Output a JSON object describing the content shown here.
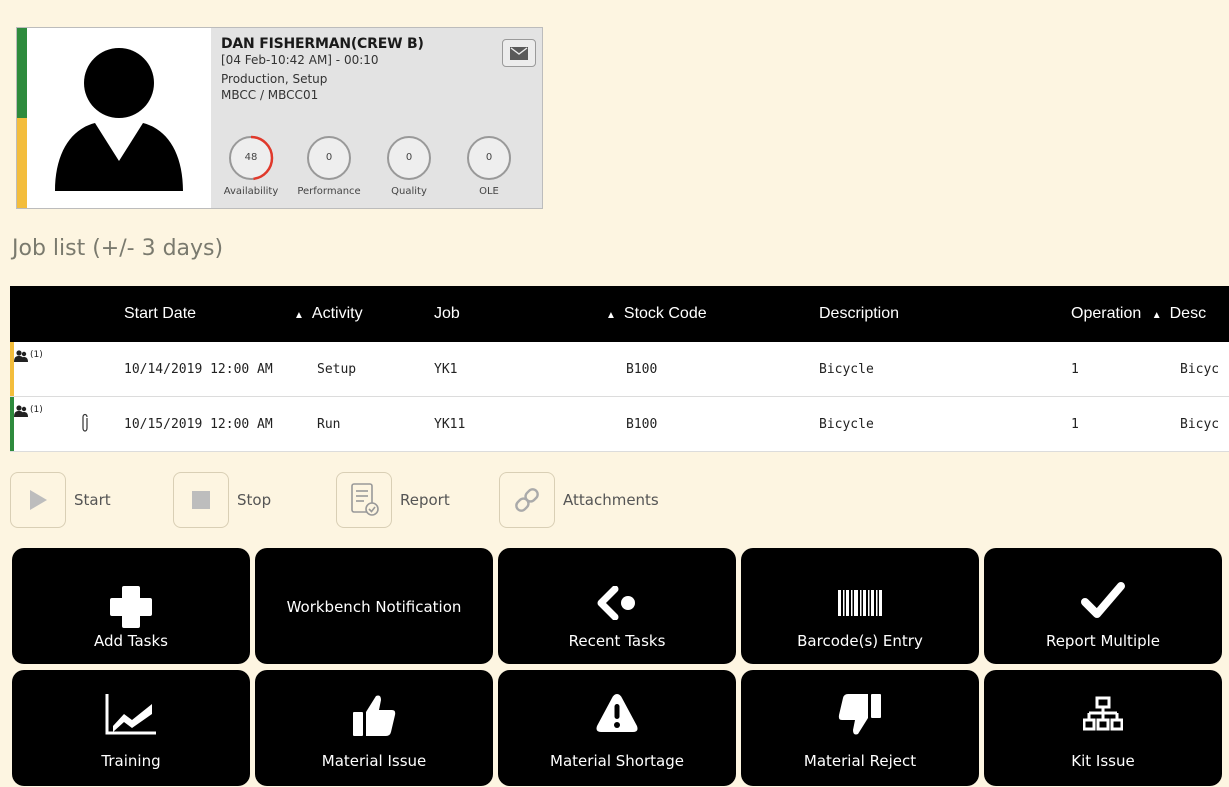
{
  "operator": {
    "name": "DAN FISHERMAN(CREW B)",
    "time": "[04 Feb-10:42 AM] - 00:10",
    "activity": "Production, Setup",
    "workcenter": "MBCC / MBCC01",
    "stripe_colors": [
      "#2e8b3d",
      "#f3bd3c"
    ],
    "gauges": [
      {
        "label": "Availability",
        "value": "48",
        "fraction": 0.48
      },
      {
        "label": "Performance",
        "value": "0",
        "fraction": 0
      },
      {
        "label": "Quality",
        "value": "0",
        "fraction": 0
      },
      {
        "label": "OLE",
        "value": "0",
        "fraction": 0
      }
    ]
  },
  "joblist": {
    "title": "Job list (+/- 3 days)",
    "columns": [
      "Start Date",
      "Activity",
      "Job",
      "Stock Code",
      "Description",
      "Operation",
      "Desc"
    ],
    "rows": [
      {
        "count": "(1)",
        "start_date": "10/14/2019 12:00 AM",
        "activity": "Setup",
        "job": "YK1",
        "stock_code": "B100",
        "description": "Bicycle",
        "operation": "1",
        "desc": "Bicyc",
        "status_color": "#f3bd3c",
        "attachment": false
      },
      {
        "count": "(1)",
        "start_date": "10/15/2019 12:00 AM",
        "activity": "Run",
        "job": "YK11",
        "stock_code": "B100",
        "description": "Bicycle",
        "operation": "1",
        "desc": "Bicyc",
        "status_color": "#2e8b3d",
        "attachment": true
      }
    ]
  },
  "actions": [
    {
      "label": "Start",
      "icon": "play-icon"
    },
    {
      "label": "Stop",
      "icon": "stop-icon"
    },
    {
      "label": "Report",
      "icon": "report-icon"
    },
    {
      "label": "Attachments",
      "icon": "link-icon"
    }
  ],
  "tiles": [
    {
      "label": "Add Tasks",
      "icon": "plus-icon"
    },
    {
      "label": "Workbench Notification",
      "icon": ""
    },
    {
      "label": "Recent Tasks",
      "icon": "recent-icon"
    },
    {
      "label": "Barcode(s) Entry",
      "icon": "barcode-icon"
    },
    {
      "label": "Report Multiple",
      "icon": "checkmark-icon"
    },
    {
      "label": "Training",
      "icon": "chart-icon"
    },
    {
      "label": "Material Issue",
      "icon": "thumbs-up-icon"
    },
    {
      "label": "Material Shortage",
      "icon": "warning-icon"
    },
    {
      "label": "Material Reject",
      "icon": "thumbs-down-icon"
    },
    {
      "label": "Kit Issue",
      "icon": "hierarchy-icon"
    }
  ],
  "colors": {
    "background": "#fdf5e1",
    "gauge_arc": "#e0392b",
    "tile": "#000000"
  }
}
